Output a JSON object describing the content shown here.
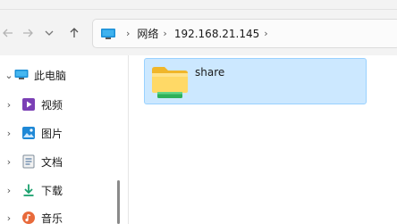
{
  "toolbar": {
    "back_icon": "back-arrow-icon",
    "forward_icon": "forward-arrow-icon",
    "history_icon": "chevron-down-icon",
    "up_icon": "up-arrow-icon"
  },
  "address": {
    "location_icon": "network-computer-icon",
    "crumbs": [
      "网络",
      "192.168.21.145"
    ],
    "separator": "›"
  },
  "sidebar": {
    "items": [
      {
        "label": "此电脑",
        "icon": "this-pc-icon",
        "expanded": true
      },
      {
        "label": "视频",
        "icon": "videos-icon"
      },
      {
        "label": "图片",
        "icon": "pictures-icon"
      },
      {
        "label": "文档",
        "icon": "documents-icon"
      },
      {
        "label": "下载",
        "icon": "downloads-icon"
      },
      {
        "label": "音乐",
        "icon": "music-icon"
      }
    ]
  },
  "files": [
    {
      "name": "share",
      "icon": "shared-folder-icon",
      "selected": true
    }
  ]
}
